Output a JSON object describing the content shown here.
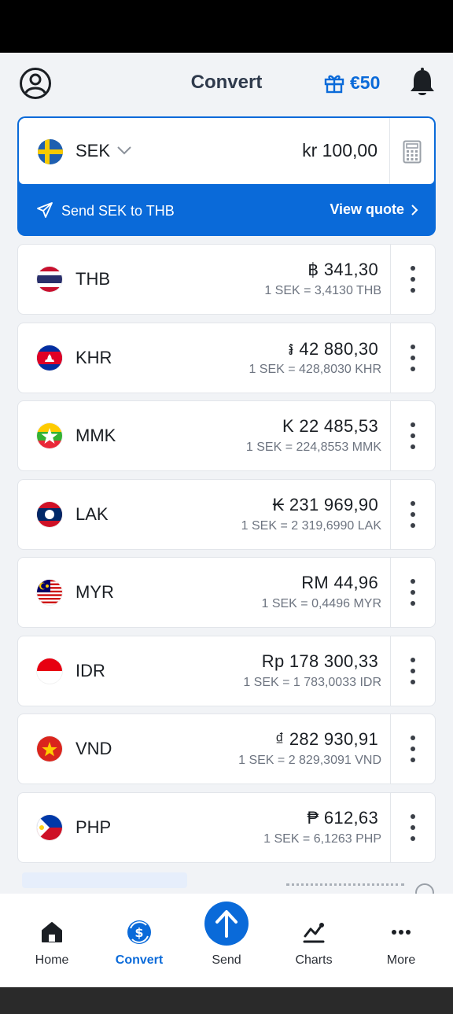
{
  "header": {
    "title": "Convert",
    "reward_amount": "€50"
  },
  "source": {
    "code": "SEK",
    "amount": "kr 100,00",
    "send_label": "Send SEK to THB",
    "view_quote_label": "View quote"
  },
  "currencies": [
    {
      "code": "THB",
      "amount": "฿ 341,30",
      "rate": "1 SEK = 3,4130 THB",
      "flag": "thailand"
    },
    {
      "code": "KHR",
      "amount": "៛ 42 880,30",
      "rate": "1 SEK = 428,8030 KHR",
      "flag": "cambodia"
    },
    {
      "code": "MMK",
      "amount": "K 22 485,53",
      "rate": "1 SEK = 224,8553 MMK",
      "flag": "myanmar"
    },
    {
      "code": "LAK",
      "amount": "₭ 231 969,90",
      "rate": "1 SEK = 2 319,6990 LAK",
      "flag": "laos"
    },
    {
      "code": "MYR",
      "amount": "RM 44,96",
      "rate": "1 SEK = 0,4496 MYR",
      "flag": "malaysia"
    },
    {
      "code": "IDR",
      "amount": "Rp 178 300,33",
      "rate": "1 SEK = 1 783,0033 IDR",
      "flag": "indonesia"
    },
    {
      "code": "VND",
      "amount": "₫ 282 930,91",
      "rate": "1 SEK = 2 829,3091 VND",
      "flag": "vietnam"
    },
    {
      "code": "PHP",
      "amount": "₱ 612,63",
      "rate": "1 SEK = 6,1263 PHP",
      "flag": "philippines"
    }
  ],
  "nav": [
    {
      "label": "Home",
      "icon": "home-icon",
      "active": false
    },
    {
      "label": "Convert",
      "icon": "convert-icon",
      "active": true
    },
    {
      "label": "Send",
      "icon": "send-arrow-icon",
      "active": false
    },
    {
      "label": "Charts",
      "icon": "charts-icon",
      "active": false
    },
    {
      "label": "More",
      "icon": "more-icon",
      "active": false
    }
  ],
  "colors": {
    "accent": "#0a6ad9",
    "background": "#f1f3f6"
  }
}
